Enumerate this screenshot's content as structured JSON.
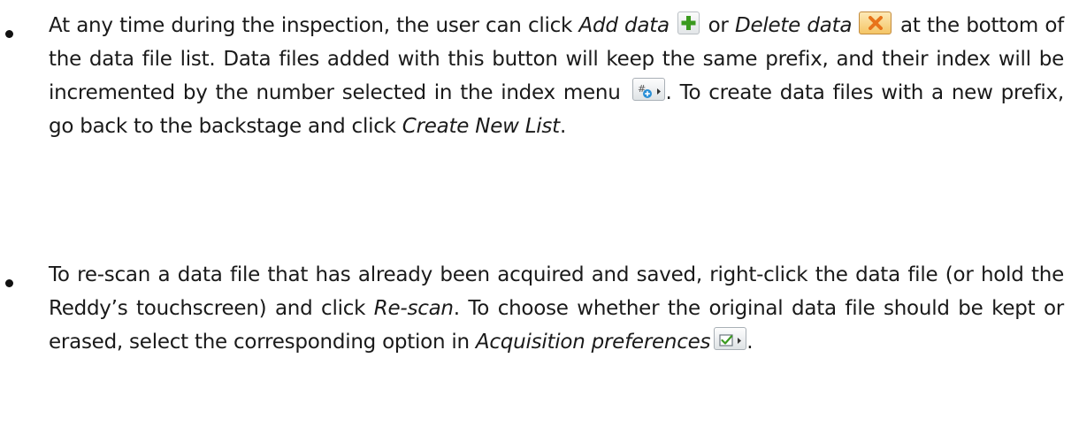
{
  "bullets": [
    {
      "t1": "At any time during the inspection, the user can click ",
      "add_label": "Add data",
      "t2": " or ",
      "delete_label": "Delete data",
      "t3": " at the bottom of the data file list. Data files added with this button will keep the same prefix, and their index will be incremented by the number selected in the index menu ",
      "t4": ". To create data files with a new prefix, go back to the backstage and click ",
      "create_label": "Create New List",
      "t5": "."
    },
    {
      "t1": "To re-scan a data file that has already been acquired and saved, right-click the data file (or hold the Reddy’s touchscreen) and click ",
      "rescan_label": "Re-scan",
      "t2": ". To choose whether the original data file should be kept or erased, select the corresponding option in ",
      "prefs_label": "Acquisition preferences",
      "t3": "."
    }
  ],
  "icons": {
    "add": "add-data-icon",
    "delete": "delete-data-icon",
    "index": "index-menu-icon",
    "prefs": "acquisition-preferences-icon"
  },
  "colors": {
    "add_plus": "#3a9a1e",
    "delete_x": "#e8731a",
    "index_badge": "#2a8fd6"
  }
}
